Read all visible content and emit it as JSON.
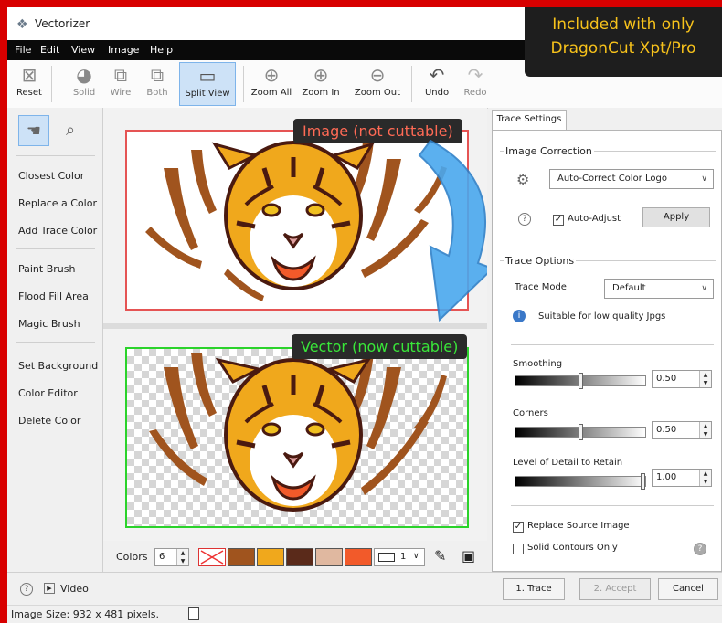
{
  "window": {
    "title": "Vectorizer"
  },
  "menu": [
    "File",
    "Edit",
    "View",
    "Image",
    "Help"
  ],
  "callout": {
    "line1": "Included with only",
    "line2": "DragonCut Xpt/Pro"
  },
  "toolbar": {
    "reset": "Reset",
    "solid": "Solid",
    "wire": "Wire",
    "both": "Both",
    "split": "Split View",
    "zoom_all": "Zoom All",
    "zoom_in": "Zoom In",
    "zoom_out": "Zoom Out",
    "undo": "Undo",
    "redo": "Redo"
  },
  "left_panel": {
    "items": [
      "Closest Color",
      "Replace a Color",
      "Add Trace Color",
      "Paint Brush",
      "Flood Fill Area",
      "Magic Brush",
      "Set Background",
      "Color Editor",
      "Delete Color"
    ]
  },
  "view": {
    "top_label": "Image (not cuttable)",
    "bottom_label": "Vector (now cuttable)"
  },
  "colors_bar": {
    "label": "Colors",
    "count": "6",
    "line_width": "1",
    "swatches": [
      "#a0541e",
      "#f0a81c",
      "#5a2a1a",
      "#e0b8a0",
      "#f25a2a"
    ]
  },
  "trace_settings": {
    "tab": "Trace Settings",
    "image_correction": {
      "label": "Image Correction",
      "mode": "Auto-Correct Color Logo",
      "auto_adjust": "Auto-Adjust",
      "apply": "Apply"
    },
    "trace_options": {
      "label": "Trace Options",
      "mode_label": "Trace Mode",
      "mode": "Default",
      "hint": "Suitable for low quality Jpgs"
    },
    "smoothing": {
      "label": "Smoothing",
      "value": "0.50",
      "fraction": 0.5
    },
    "corners": {
      "label": "Corners",
      "value": "0.50",
      "fraction": 0.5
    },
    "detail": {
      "label": "Level of Detail to Retain",
      "value": "1.00",
      "fraction": 1.0
    },
    "replace_source": "Replace Source Image",
    "solid_contours": "Solid Contours Only"
  },
  "bottom": {
    "video": "Video",
    "trace": "1. Trace",
    "accept": "2. Accept",
    "cancel": "Cancel"
  },
  "status": {
    "text": "Image Size: 932 x 481 pixels."
  }
}
